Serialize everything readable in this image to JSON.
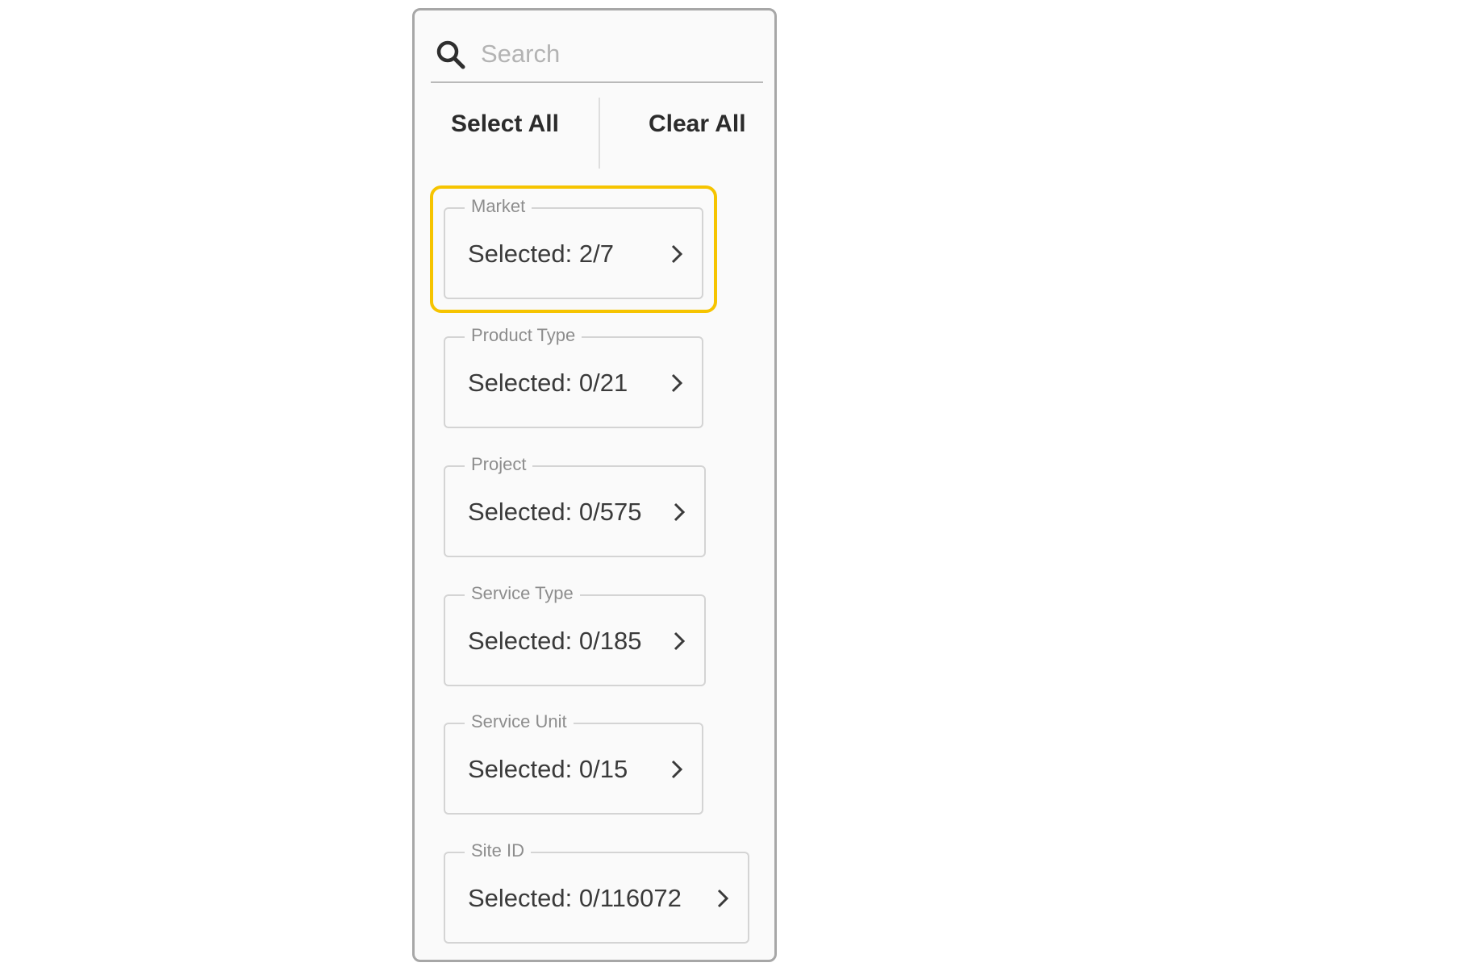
{
  "search": {
    "placeholder": "Search",
    "value": ""
  },
  "actions": {
    "select_all_label": "Select All",
    "clear_all_label": "Clear All"
  },
  "filters": [
    {
      "label": "Market",
      "value": "Selected: 2/7",
      "highlighted": true
    },
    {
      "label": "Product Type",
      "value": "Selected: 0/21",
      "highlighted": false
    },
    {
      "label": "Project",
      "value": "Selected: 0/575",
      "highlighted": false
    },
    {
      "label": "Service Type",
      "value": "Selected: 0/185",
      "highlighted": false
    },
    {
      "label": "Service Unit",
      "value": "Selected: 0/15",
      "highlighted": false
    },
    {
      "label": "Site ID",
      "value": "Selected: 0/116072",
      "highlighted": false
    }
  ],
  "icons": {
    "search": "search-icon",
    "chevron": "chevron-right-icon"
  },
  "colors": {
    "highlight": "#f6c400",
    "panel_border": "#a7a7a7",
    "text_primary": "#2b2b2b",
    "text_muted": "#8d8d8d"
  }
}
